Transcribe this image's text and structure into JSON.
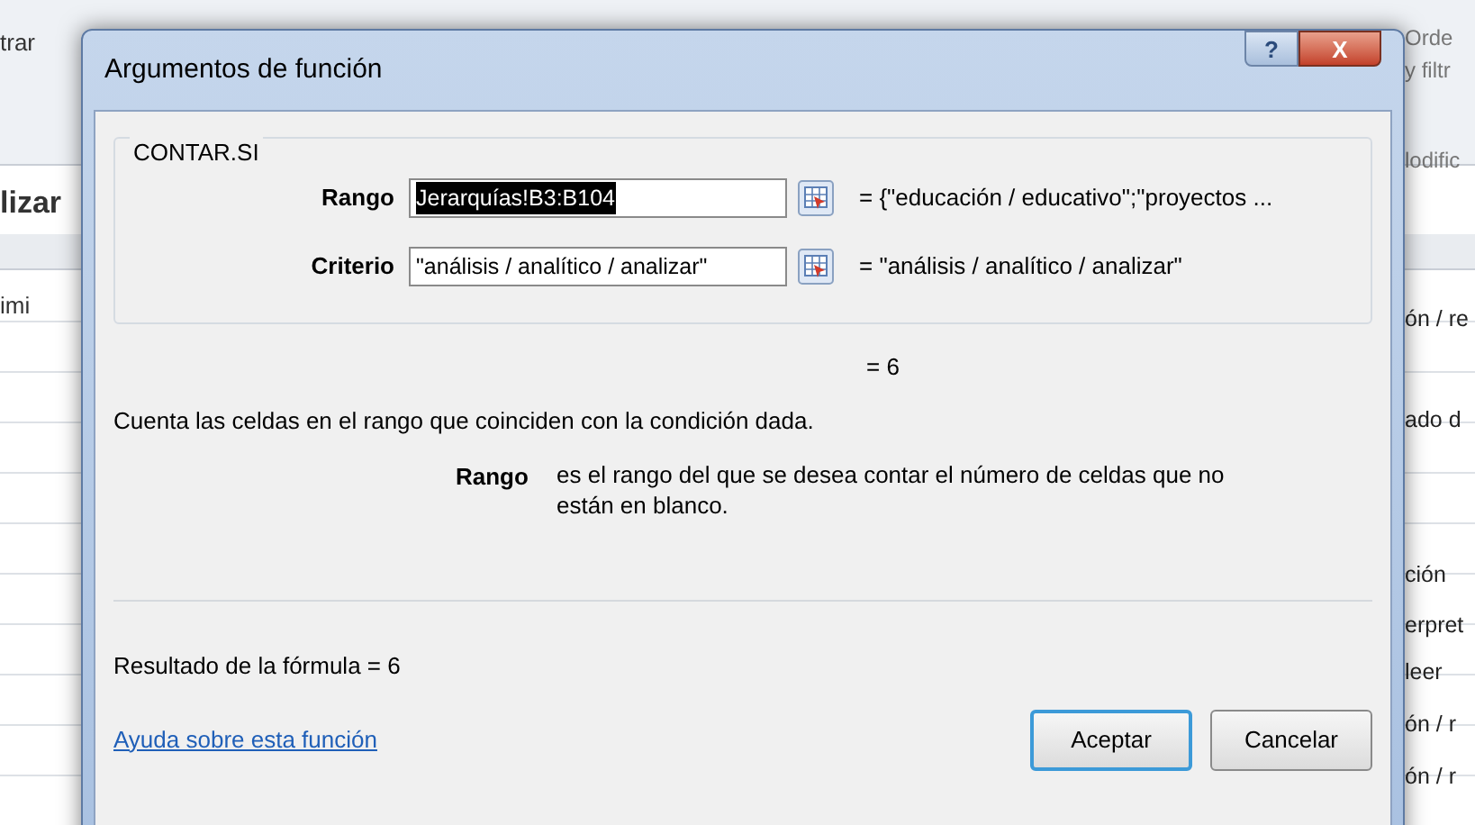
{
  "background": {
    "left_texts": [
      "trar",
      "lizar",
      "imi"
    ],
    "right_texts": [
      "Orde",
      "y filtr",
      "lodific",
      "ón / re",
      "ado d",
      "ción",
      "erpret",
      "leer",
      "ón / r",
      "ón / r"
    ]
  },
  "window": {
    "title": "Argumentos de función",
    "help_button": "?",
    "close_button": "X"
  },
  "function_name": "CONTAR.SI",
  "arguments": [
    {
      "label": "Rango",
      "value": "Jerarquías!B3:B104",
      "selected": true,
      "result": "=  {\"educación / educativo\";\"proyectos ..."
    },
    {
      "label": "Criterio",
      "value": "\"análisis / analítico / analizar\"",
      "selected": false,
      "result": "=  \"análisis / analítico / analizar\""
    }
  ],
  "function_result": "=  6",
  "description": "Cuenta las celdas en el rango que coinciden con la condición dada.",
  "argument_help": {
    "label": "Rango",
    "text": "es el rango del que se desea contar el número de celdas que no están en blanco."
  },
  "formula_result": "Resultado de la fórmula =  6",
  "help_link": "Ayuda sobre esta función",
  "buttons": [
    {
      "label": "Aceptar",
      "default": true
    },
    {
      "label": "Cancelar",
      "default": false
    }
  ]
}
